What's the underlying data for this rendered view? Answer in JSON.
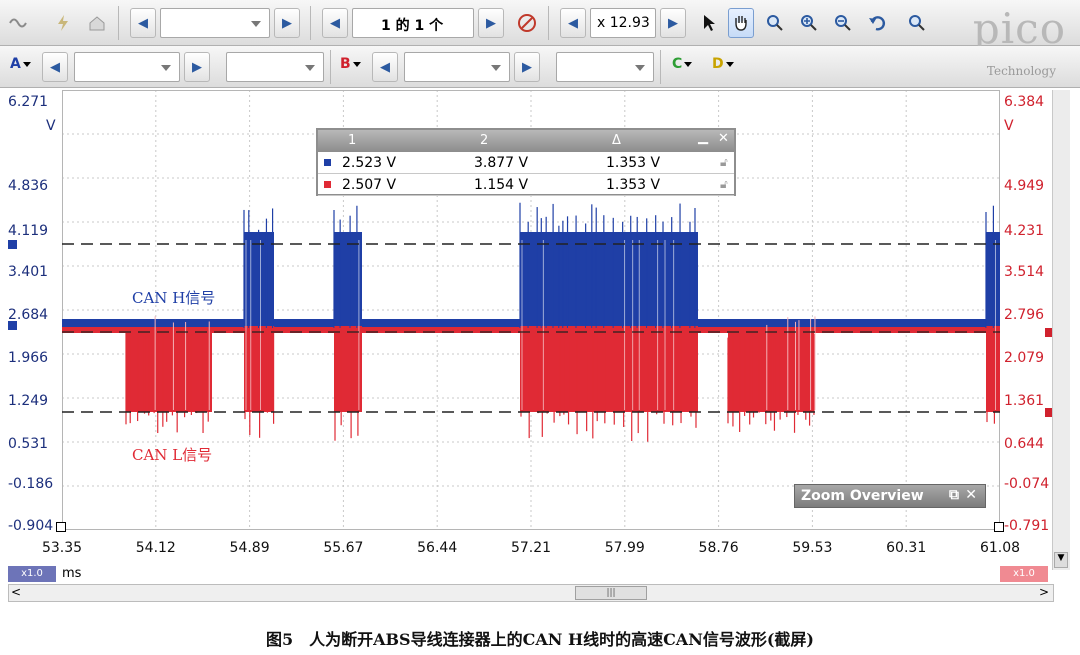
{
  "toolbar1": {
    "page_indicator": "1 的 1 个",
    "zoom_value": "x 12.93"
  },
  "toolbar2": {
    "channels": [
      "A",
      "B",
      "C",
      "D"
    ]
  },
  "logo": {
    "text": "pico",
    "sub": "Technology"
  },
  "icons": {
    "scope": "waveform-icon",
    "ruler": "signal-generator-icon",
    "home": "home-icon",
    "nav_prev": "left-arrow-icon",
    "nav_next": "right-arrow-icon",
    "compass": "no-entry-icon",
    "select": "pointer-icon",
    "hand": "hand-icon",
    "zoom_rect": "zoom-rect-icon",
    "zoom_in": "zoom-in-icon",
    "zoom_out": "zoom-out-icon",
    "undo": "undo-icon",
    "zoom_fit": "zoom-fit-icon"
  },
  "axes": {
    "left_unit": "V",
    "right_unit": "V",
    "left_ticks": [
      "6.271",
      "4.836",
      "4.119",
      "3.401",
      "2.684",
      "1.966",
      "1.249",
      "0.531",
      "-0.186",
      "-0.904"
    ],
    "right_ticks": [
      "6.384",
      "4.949",
      "4.231",
      "3.514",
      "2.796",
      "2.079",
      "1.361",
      "0.644",
      "-0.074",
      "-0.791"
    ],
    "x_ticks": [
      "53.35",
      "54.12",
      "54.89",
      "55.67",
      "56.44",
      "57.21",
      "57.99",
      "58.76",
      "59.53",
      "60.31",
      "61.08"
    ],
    "x_unit": "ms",
    "left_scale": "x1.0",
    "right_scale": "x1.0"
  },
  "colors": {
    "can_h": "#1f3fa6",
    "can_l": "#e02a35",
    "cursor": "#222222"
  },
  "signals": {
    "can_h_label": "CAN H信号",
    "can_l_label": "CAN L信号"
  },
  "measurements": {
    "headers": [
      "1",
      "2",
      "Δ"
    ],
    "rows": [
      {
        "color": "#1f3fa6",
        "v1": "2.523 V",
        "v2": "3.877 V",
        "delta": "1.353 V"
      },
      {
        "color": "#e02a35",
        "v1": "2.507 V",
        "v2": "1.154 V",
        "delta": "1.353 V"
      }
    ]
  },
  "zoom_overview": {
    "title": "Zoom Overview"
  },
  "caption": "图5　人为断开ABS导线连接器上的CAN H线时的高速CAN信号波形(截屏)"
}
